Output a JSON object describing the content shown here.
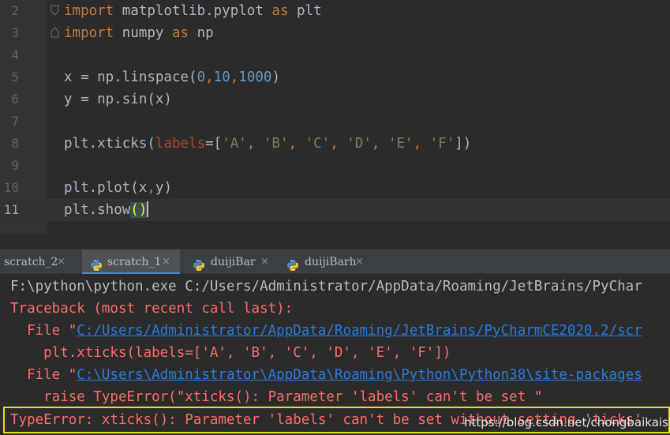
{
  "editor": {
    "lines": [
      {
        "num": "2",
        "tokens": [
          {
            "t": "import",
            "c": "kw"
          },
          {
            "t": " matplotlib.pyplot ",
            "c": ""
          },
          {
            "t": "as",
            "c": "kw"
          },
          {
            "t": " plt",
            "c": ""
          }
        ],
        "fold": "open"
      },
      {
        "num": "3",
        "tokens": [
          {
            "t": "import",
            "c": "kw"
          },
          {
            "t": " numpy ",
            "c": ""
          },
          {
            "t": "as",
            "c": "kw"
          },
          {
            "t": " np",
            "c": ""
          }
        ],
        "fold": "close"
      },
      {
        "num": "4",
        "tokens": []
      },
      {
        "num": "5",
        "tokens": [
          {
            "t": "x = np.linspace(",
            "c": ""
          },
          {
            "t": "0",
            "c": "num"
          },
          {
            "t": ",",
            "c": "kw"
          },
          {
            "t": "10",
            "c": "num"
          },
          {
            "t": ",",
            "c": "kw"
          },
          {
            "t": "1000",
            "c": "num"
          },
          {
            "t": ")",
            "c": ""
          }
        ]
      },
      {
        "num": "6",
        "tokens": [
          {
            "t": "y = np.sin(x)",
            "c": ""
          }
        ]
      },
      {
        "num": "7",
        "tokens": []
      },
      {
        "num": "8",
        "tokens": [
          {
            "t": "plt.xticks(",
            "c": ""
          },
          {
            "t": "labels",
            "c": "param"
          },
          {
            "t": "=[",
            "c": ""
          },
          {
            "t": "'A'",
            "c": "str"
          },
          {
            "t": ", ",
            "c": "kw"
          },
          {
            "t": "'B'",
            "c": "str"
          },
          {
            "t": ", ",
            "c": "kw"
          },
          {
            "t": "'C'",
            "c": "str"
          },
          {
            "t": ", ",
            "c": "kw"
          },
          {
            "t": "'D'",
            "c": "str"
          },
          {
            "t": ", ",
            "c": "kw"
          },
          {
            "t": "'E'",
            "c": "str"
          },
          {
            "t": ", ",
            "c": "kw"
          },
          {
            "t": "'F'",
            "c": "str"
          },
          {
            "t": "])",
            "c": ""
          }
        ]
      },
      {
        "num": "9",
        "tokens": []
      },
      {
        "num": "10",
        "tokens": [
          {
            "t": "plt.plot(x",
            "c": ""
          },
          {
            "t": ",",
            "c": "kw"
          },
          {
            "t": "y)",
            "c": ""
          }
        ]
      },
      {
        "num": "11",
        "tokens": [
          {
            "t": "plt.show",
            "c": ""
          },
          {
            "t": "()",
            "c": "paren-hl"
          }
        ],
        "current": true,
        "caret": true
      }
    ]
  },
  "tabs": [
    {
      "label": "scratch_2",
      "icon": "none",
      "close": "×"
    },
    {
      "label": "scratch_1",
      "icon": "python-icon",
      "close": "×",
      "active": true
    },
    {
      "label": "duijiBar",
      "icon": "python-icon",
      "close": "×"
    },
    {
      "label": "duijiBarh",
      "icon": "python-icon",
      "close": "×"
    }
  ],
  "console": {
    "line1": "F:\\python\\python.exe C:/Users/Administrator/AppData/Roaming/JetBrains/PyChar",
    "line2": "Traceback (most recent call last):",
    "line3_prefix": "  File \"",
    "line3_link": "C:/Users/Administrator/AppData/Roaming/JetBrains/PyCharmCE2020.2/scr",
    "line4": "    plt.xticks(labels=['A', 'B', 'C', 'D', 'E', 'F'])",
    "line5_prefix": "  File \"",
    "line5_link": "C:\\Users\\Administrator\\AppData\\Roaming\\Python\\Python38\\site-packages",
    "line6": "    raise TypeError(\"xticks(): Parameter 'labels' can't be set \"",
    "line7": "TypeError: xticks(): Parameter 'labels' can't be set without setting 'ticks'"
  },
  "watermark": "https://blog.csdn.net/chongbaikaishi",
  "colors": {
    "highlight_box": "#e4e21b",
    "error_text": "#ff6b68",
    "link": "#287bde"
  }
}
